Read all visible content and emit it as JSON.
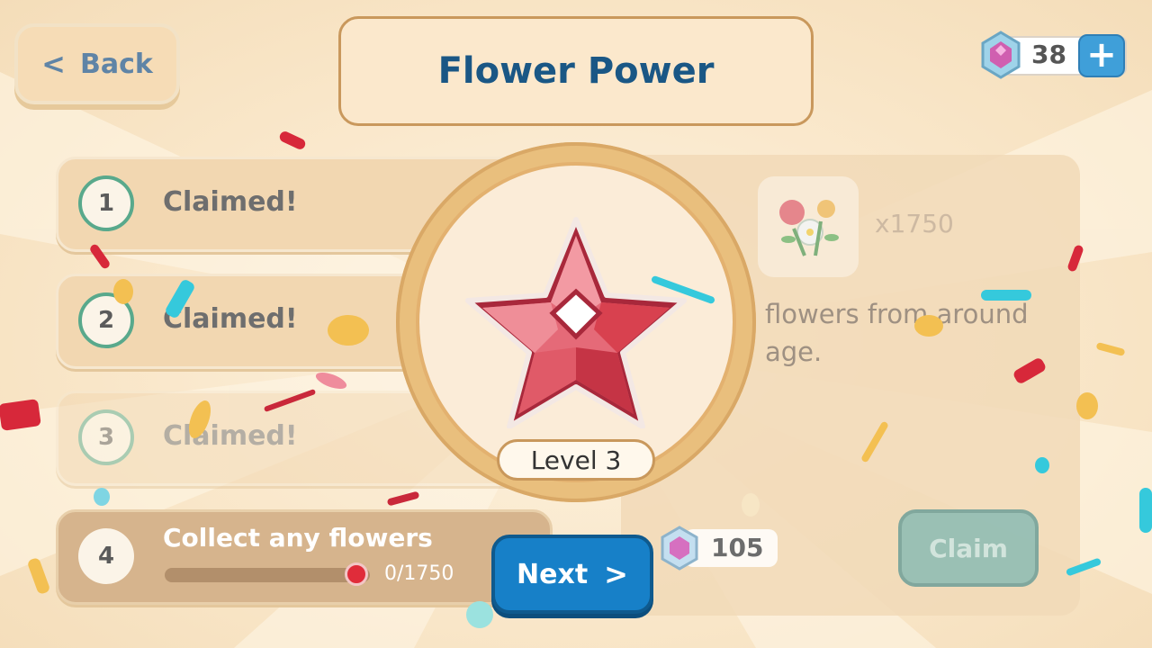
{
  "header": {
    "back_label": "Back",
    "title": "Flower Power",
    "gems": "38",
    "add_icon": "plus-icon"
  },
  "tasks": [
    {
      "number": "1",
      "status": "Claimed!"
    },
    {
      "number": "2",
      "status": "Claimed!"
    },
    {
      "number": "3",
      "status": "Claimed!"
    },
    {
      "number": "4",
      "status": "Collect any flowers",
      "progress_text": "0/1750",
      "progress": 0
    }
  ],
  "reward": {
    "count": "x1750",
    "description_line1": "flowers from around",
    "description_line2": "age.",
    "gem_reward": "105",
    "claim_label": "Claim"
  },
  "popup": {
    "level_label": "Level 3",
    "next_label": "Next"
  },
  "colors": {
    "title_text": "#1a5785",
    "accent_blue": "#1780c8",
    "star_red": "#d8414f"
  }
}
